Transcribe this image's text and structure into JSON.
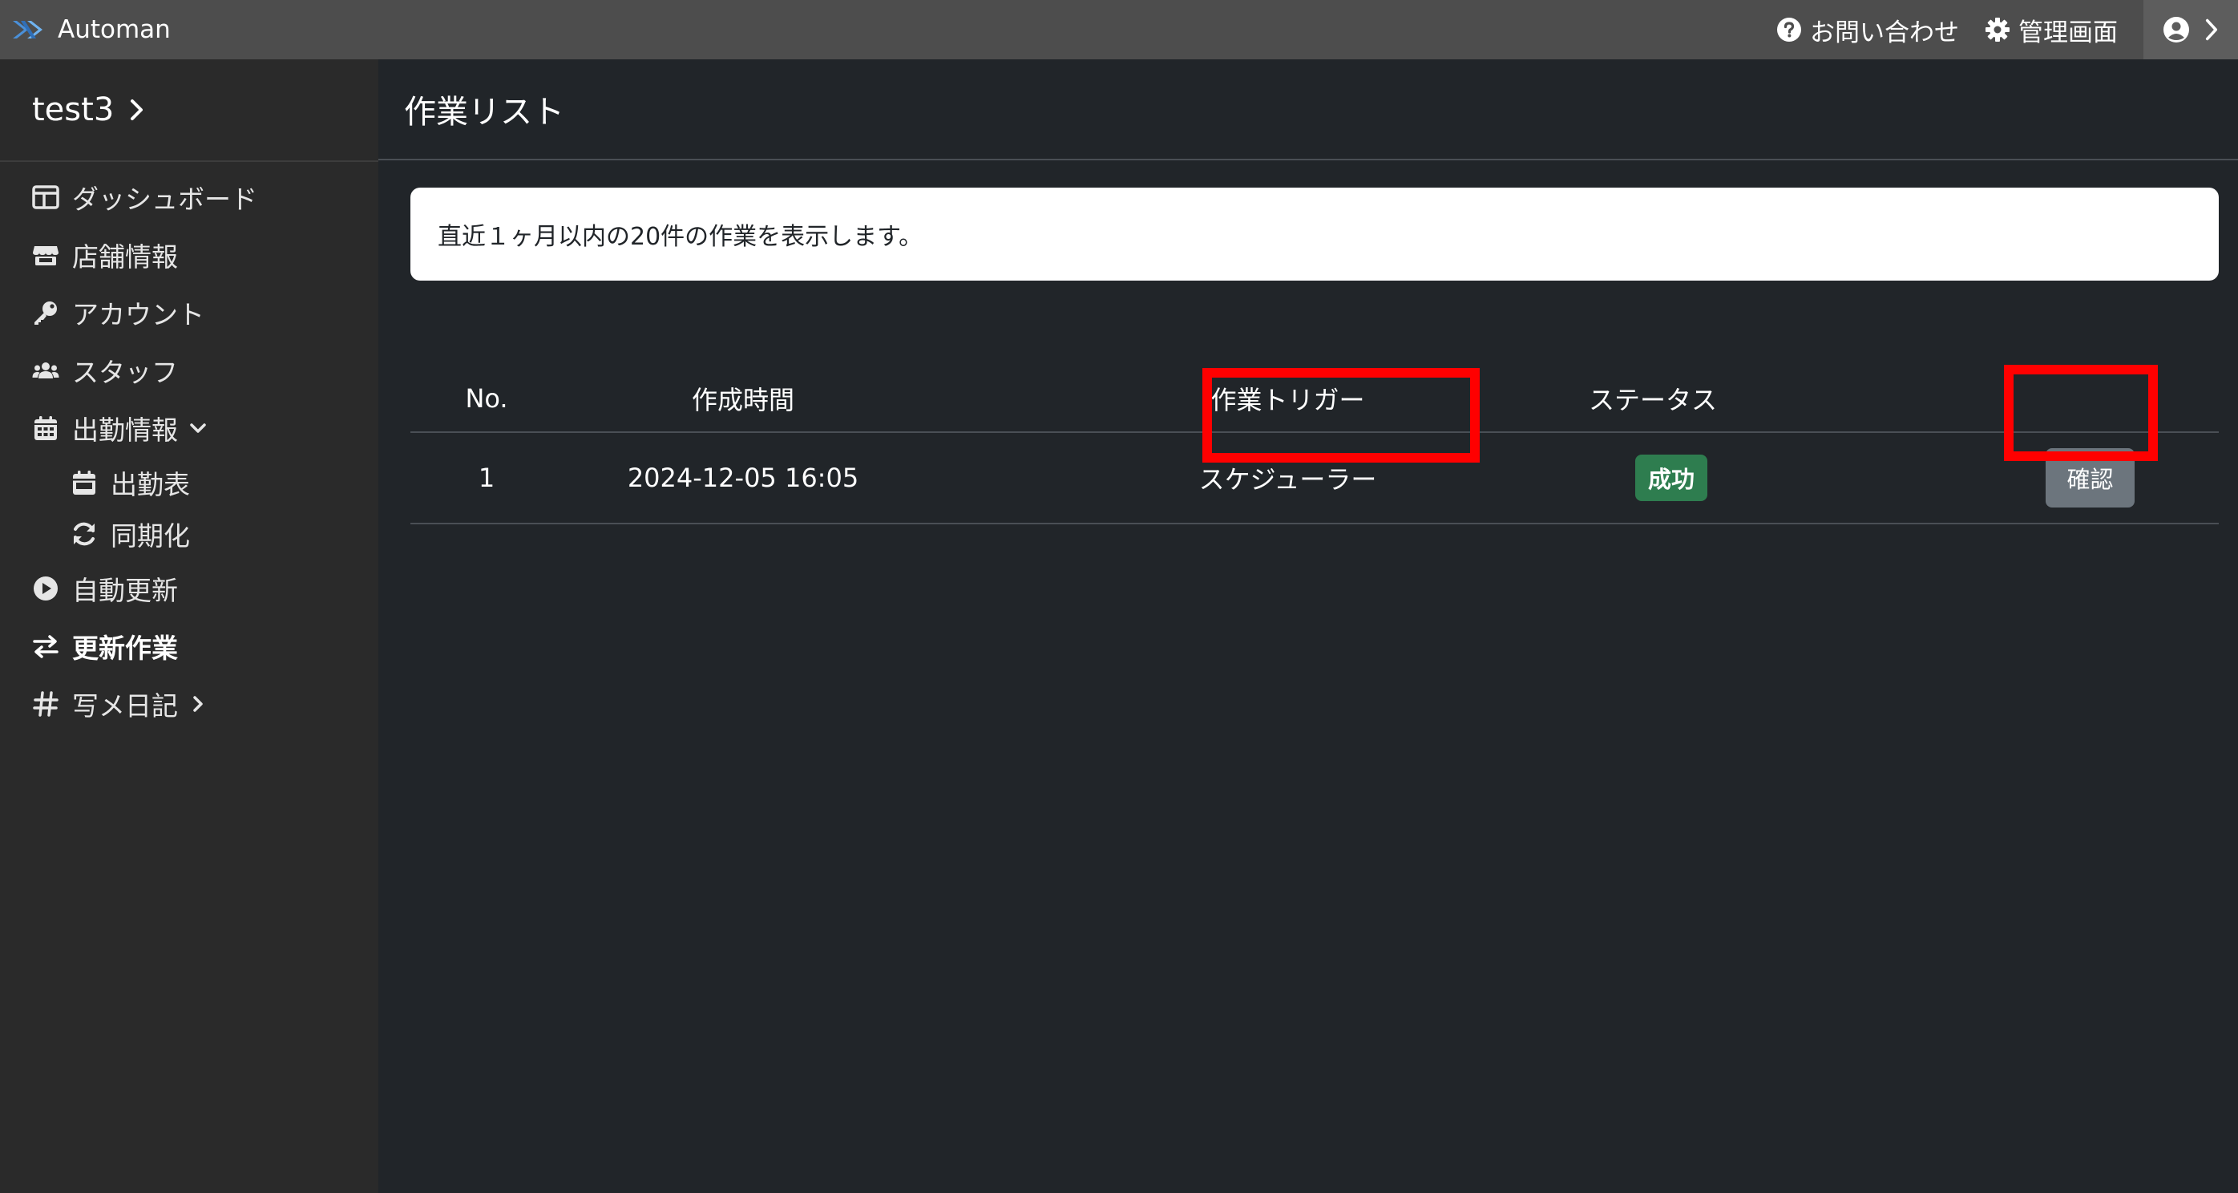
{
  "topbar": {
    "app_name": "Automan",
    "contact_label": "お問い合わせ",
    "admin_label": "管理画面"
  },
  "sidebar": {
    "project_name": "test3",
    "items": [
      {
        "label": "ダッシュボード",
        "icon": "dashboard-icon"
      },
      {
        "label": "店舗情報",
        "icon": "store-icon"
      },
      {
        "label": "アカウント",
        "icon": "key-icon"
      },
      {
        "label": "スタッフ",
        "icon": "users-icon"
      },
      {
        "label": "出勤情報",
        "icon": "calendar-icon",
        "expanded": true
      },
      {
        "label": "出勤表",
        "icon": "calendar-day-icon"
      },
      {
        "label": "同期化",
        "icon": "sync-icon"
      },
      {
        "label": "自動更新",
        "icon": "play-circle-icon"
      },
      {
        "label": "更新作業",
        "icon": "exchange-icon",
        "active": true
      },
      {
        "label": "写メ日記",
        "icon": "hashtag-icon"
      }
    ]
  },
  "main": {
    "title": "作業リスト",
    "notice": "直近１ヶ月以内の20件の作業を表示します。",
    "table": {
      "headers": [
        "No.",
        "作成時間",
        "作業トリガー",
        "ステータス",
        ""
      ],
      "rows": [
        {
          "no": "1",
          "created": "2024-12-05 16:05",
          "trigger": "スケジューラー",
          "status": "成功",
          "action": "確認"
        }
      ]
    }
  },
  "colors": {
    "topbar": "#4d4d4d",
    "sidebar": "#2a2a2a",
    "main_bg": "#212529",
    "success_badge": "#2e7d4f",
    "confirm_button": "#6c757d",
    "highlight": "#ff0000"
  }
}
